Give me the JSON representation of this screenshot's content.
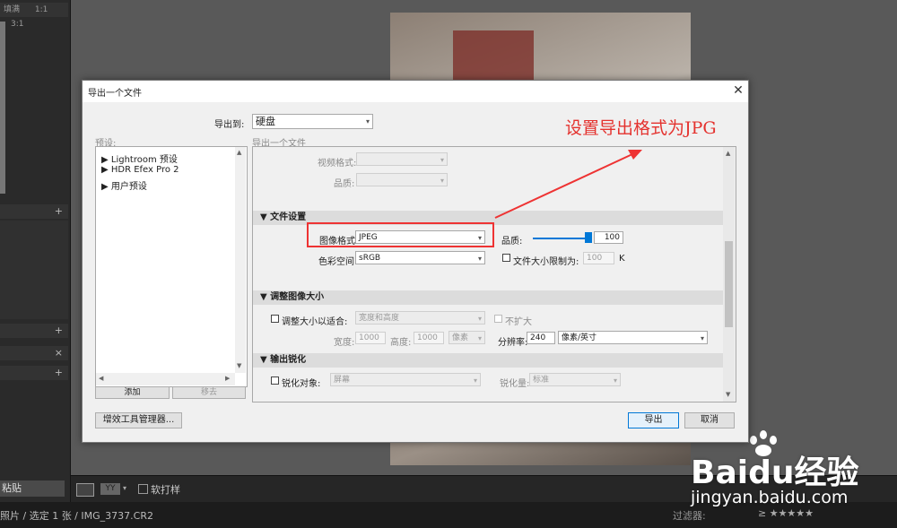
{
  "background": {
    "left_panel": {
      "header": "填满",
      "zoom_1": "1:1",
      "zoom_2": "3:1"
    },
    "toolbar": {
      "paste_label": "粘贴",
      "soft_proof_label": "软打样"
    },
    "status": {
      "text": "照片 / 选定 1 张 / IMG_3737.CR2",
      "filter_label": "过滤器:",
      "stars": "≥ ★★★★★"
    },
    "watermark": {
      "brand": "Baidu经验",
      "url": "jingyan.baidu.com"
    }
  },
  "dialog": {
    "title": "导出一个文件",
    "close_glyph": "✕",
    "export_to_label": "导出到:",
    "export_to_value": "硬盘",
    "presets_label": "预设:",
    "settings_caption": "导出一个文件",
    "presets": [
      "Lightroom 预设",
      "HDR Efex Pro 2",
      "用户预设"
    ],
    "add_button": "添加",
    "remove_button": "移去",
    "plugin_button": "增效工具管理器...",
    "export_button": "导出",
    "cancel_button": "取消",
    "video": {
      "format_label": "视频格式:",
      "quality_label": "品质:"
    },
    "file_settings": {
      "header": "文件设置",
      "image_format_label": "图像格式:",
      "image_format_value": "JPEG",
      "quality_label": "品质:",
      "quality_value": "100",
      "color_space_label": "色彩空间:",
      "color_space_value": "sRGB",
      "limit_size_label": "文件大小限制为:",
      "limit_size_value": "100",
      "limit_unit": "K"
    },
    "resize": {
      "header": "调整图像大小",
      "fit_label": "调整大小以适合:",
      "fit_value": "宽度和高度",
      "no_enlarge_label": "不扩大",
      "width_label": "宽度:",
      "width_value": "1000",
      "height_label": "高度:",
      "height_value": "1000",
      "unit_value": "像素",
      "resolution_label": "分辨率:",
      "resolution_value": "240",
      "resolution_unit": "像素/英寸"
    },
    "sharpen": {
      "header": "输出锐化",
      "sharpen_for_label": "锐化对象:",
      "sharpen_for_value": "屏幕",
      "amount_label": "锐化量:",
      "amount_value": "标准"
    }
  },
  "annotation": {
    "text": "设置导出格式为JPG",
    "color": "#e4322e"
  }
}
